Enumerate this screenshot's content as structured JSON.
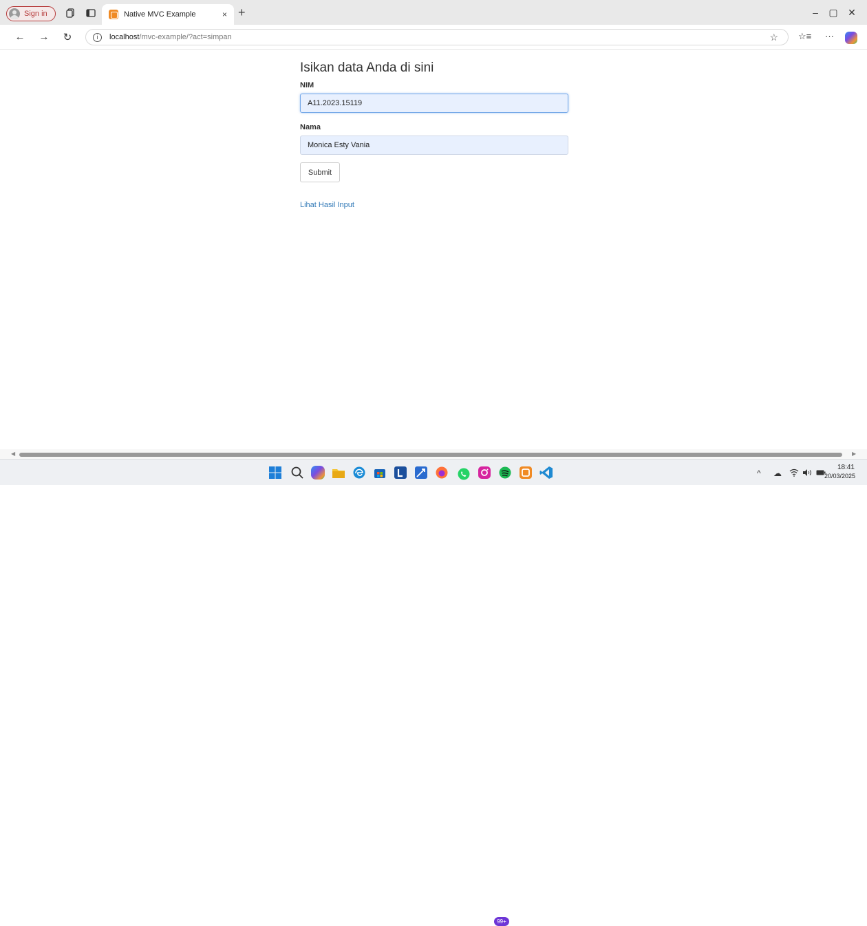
{
  "browser": {
    "signin_label": "Sign in",
    "tab_title": "Native MVC Example",
    "tab_close": "×",
    "new_tab": "+",
    "url_host": "localhost",
    "url_path": "/mvc-example/?act=simpan",
    "window": {
      "minimize": "–",
      "maximize": "▢",
      "close": "✕"
    }
  },
  "form": {
    "heading": "Isikan data Anda di sini",
    "nim_label": "NIM",
    "nim_value": "A11.2023.15119",
    "nama_label": "Nama",
    "nama_value": "Monica Esty Vania",
    "submit_label": "Submit",
    "result_link": "Lihat Hasil Input"
  },
  "taskbar": {
    "badge": "99+",
    "time": "18:41",
    "date": "20/03/2025"
  },
  "colors": {
    "link": "#337ab7",
    "input_bg": "#e8f0fe",
    "signin": "#b63c3c"
  }
}
